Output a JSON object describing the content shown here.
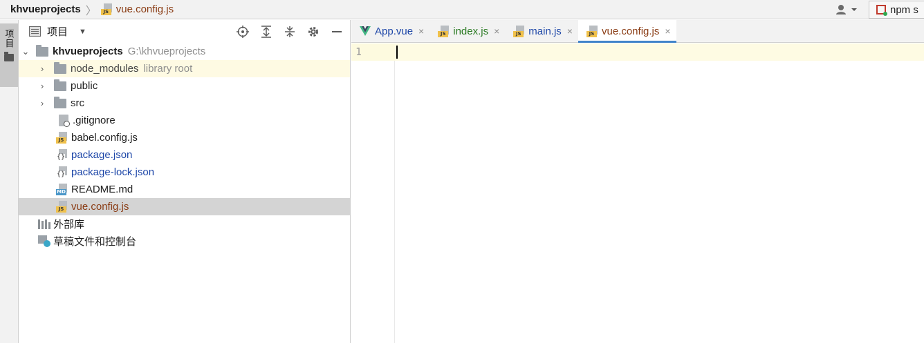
{
  "breadcrumb": {
    "project": "khvueprojects",
    "file": "vue.config.js",
    "file_icon": "js-file-icon"
  },
  "toolbar": {
    "npm_label": "npm s",
    "user_icon": "user-icon"
  },
  "toolstrip": {
    "project_tab_label": "项目"
  },
  "panel": {
    "title": "项目",
    "tools": [
      "locate-icon",
      "expand-all-icon",
      "collapse-all-icon",
      "gear-icon",
      "minimize-icon"
    ]
  },
  "tree": {
    "root": {
      "name": "khvueprojects",
      "path": "G:\\khvueprojects"
    },
    "node_modules": {
      "name": "node_modules",
      "hint": "library root"
    },
    "public": "public",
    "src": "src",
    "gitignore": ".gitignore",
    "babel": "babel.config.js",
    "package_json": "package.json",
    "package_lock": "package-lock.json",
    "readme": "README.md",
    "vue_config": "vue.config.js",
    "external_libs": "外部库",
    "scratches": "草稿文件和控制台"
  },
  "tabs": [
    {
      "label": "App.vue",
      "close": "×"
    },
    {
      "label": "index.js",
      "close": "×"
    },
    {
      "label": "main.js",
      "close": "×"
    },
    {
      "label": "vue.config.js",
      "close": "×"
    }
  ],
  "editor": {
    "line_number": "1"
  },
  "colors": {
    "accent": "#4083c9",
    "selected_row": "#d4d4d4",
    "highlight_row": "#fefae3",
    "modified_brown": "#8a3c14",
    "navy": "#1e47a8",
    "green": "#2a7a22",
    "vue_green": "#41b883"
  }
}
